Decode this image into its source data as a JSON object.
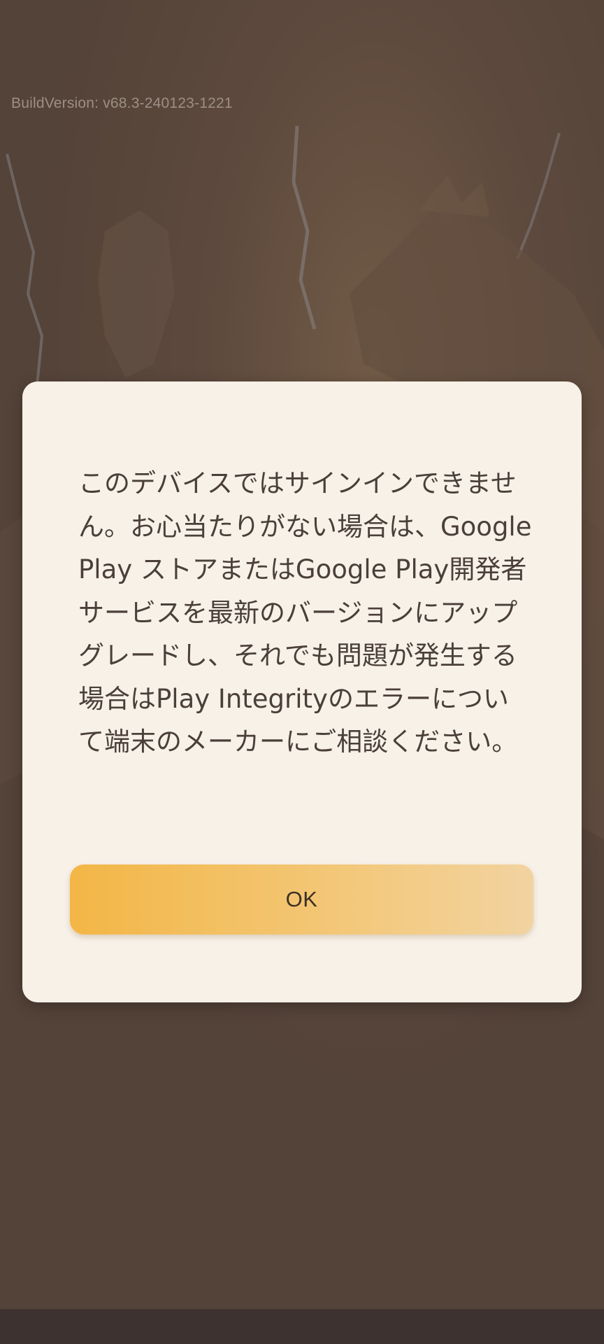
{
  "app": {
    "build_version": "BuildVersion: v68.3-240123-1221"
  },
  "dialog": {
    "message": "このデバイスではサインインできません。お心当たりがない場合は、Google Play ストアまたはGoogle Play開発者サービスを最新のバージョンにアップグレードし、それでも問題が発生する場合はPlay Integrityのエラーについて端末のメーカーにご相談ください。",
    "ok_label": "OK"
  },
  "colors": {
    "dialog_background": "#f8f1e8",
    "button_gradient_start": "#f3b646",
    "button_gradient_end": "#f2d3a0",
    "text": "#4a3f39",
    "overlay": "#5d4b3f"
  }
}
